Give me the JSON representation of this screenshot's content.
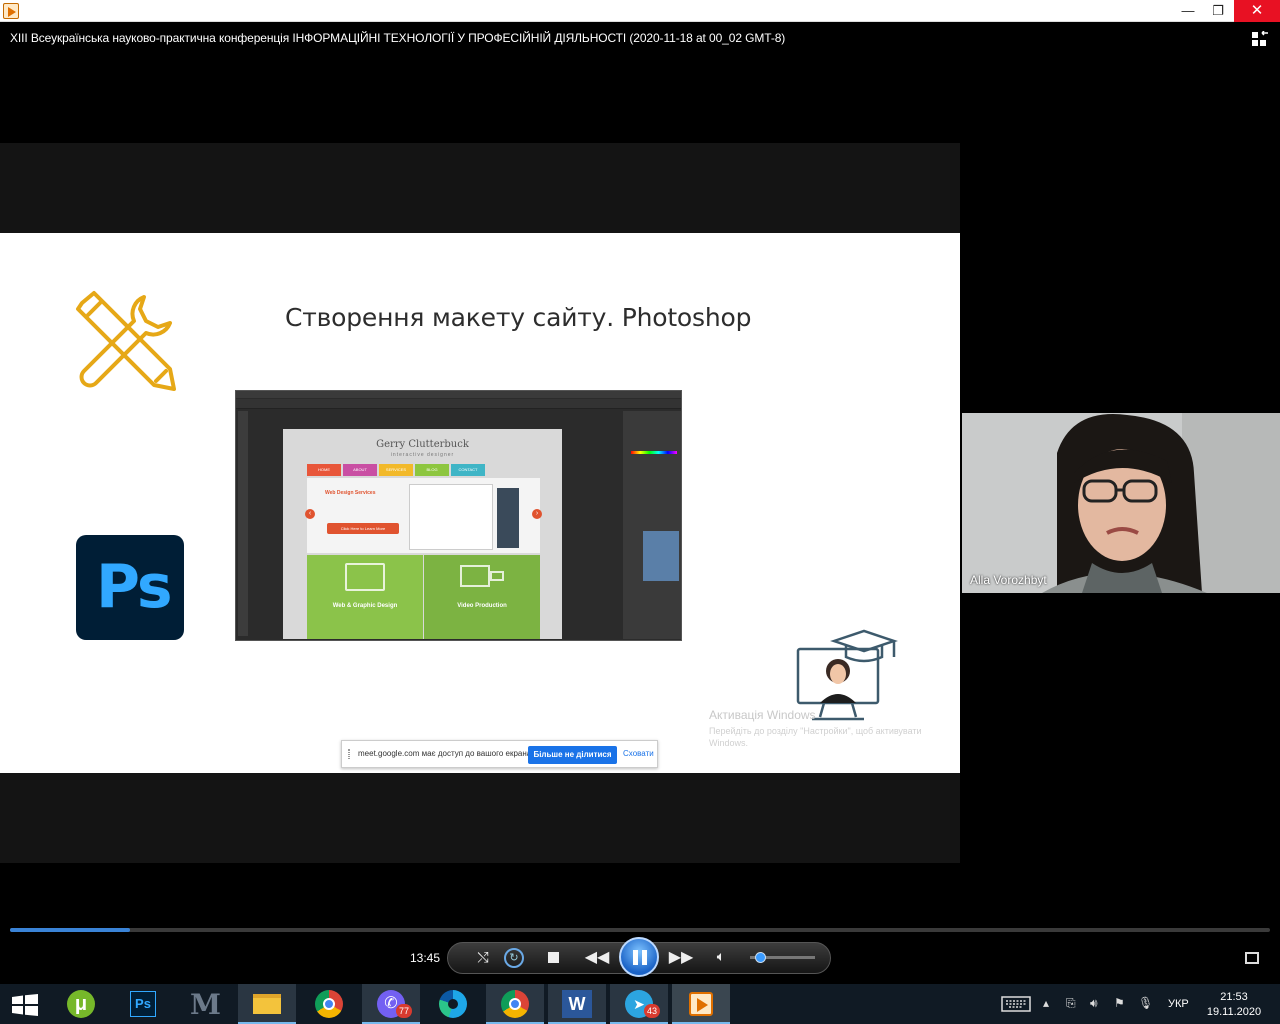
{
  "window": {
    "minimize": "—",
    "restore": "❐",
    "close": "✕"
  },
  "video": {
    "title": "XIII Всеукраїнська науково-практична конференція  ІНФОРМАЦІЙНІ ТЕХНОЛОГІЇ У ПРОФЕСІЙНІЙ ДІЯЛЬНОСТІ (2020-11-18 at 00_02 GMT-8)"
  },
  "slide": {
    "title": "Створення макету сайту. Photoshop",
    "ps_logo_text": "Ps",
    "mock_site": {
      "name": "Gerry Clutterbuck",
      "subtitle": "interactive designer",
      "nav": [
        "HOME",
        "ABOUT",
        "SERVICES",
        "BLOG",
        "CONTACT"
      ],
      "nav_colors": [
        "#e8563a",
        "#c94fa3",
        "#f2b92a",
        "#8dc63f",
        "#3fb5c6"
      ],
      "hero_title": "Web Design Services",
      "hero_button": "Click Here to Learn More",
      "card1": "Web & Graphic Design",
      "card2": "Video Production"
    }
  },
  "watermark": {
    "line1": "Активація Windows",
    "line2": "Перейдіть до розділу \"Настройки\", щоб активувати Windows."
  },
  "share_bar": {
    "text": "meet.google.com має доступ до вашого екрана.",
    "stop_button": "Більше не ділитися",
    "hide_link": "Сховати"
  },
  "participant": {
    "name": "Alla Vorozhbyt"
  },
  "player": {
    "time": "13:45",
    "progress_fraction": 0.095,
    "volume_fraction": 0.15
  },
  "taskbar": {
    "badges": {
      "viber": "77",
      "telegram": "43"
    },
    "language": "УКР",
    "time": "21:53",
    "date": "19.11.2020"
  }
}
